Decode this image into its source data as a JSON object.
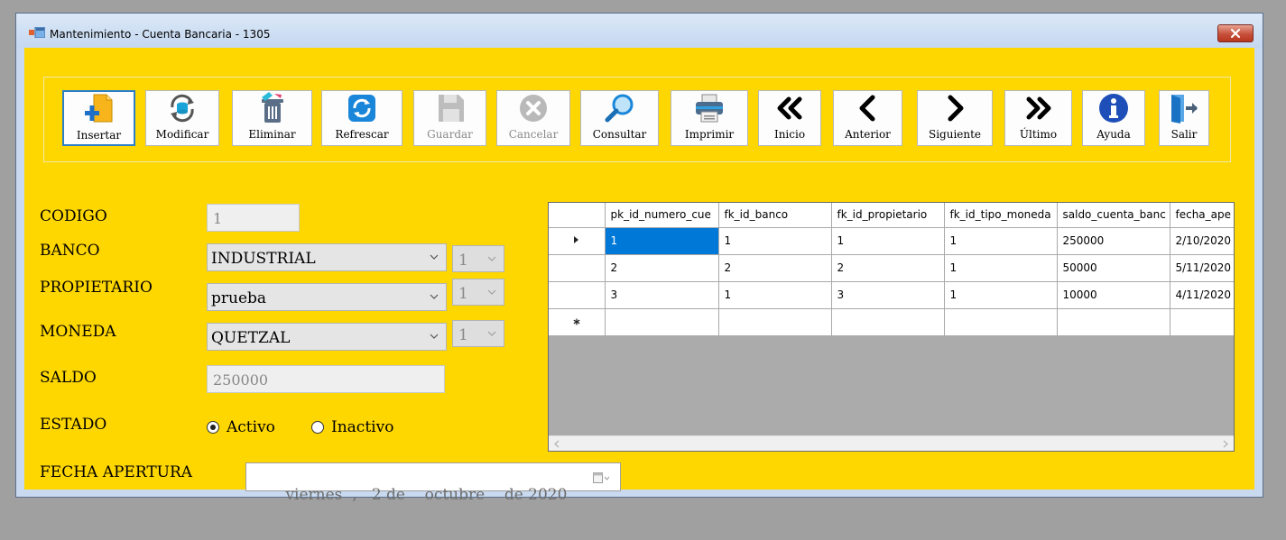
{
  "window": {
    "title": "Mantenimiento - Cuenta Bancaria - 1305"
  },
  "toolbar": [
    {
      "label": "Insertar",
      "icon": "insert-icon"
    },
    {
      "label": "Modificar",
      "icon": "modify-icon"
    },
    {
      "label": "Eliminar",
      "icon": "delete-icon"
    },
    {
      "label": "Refrescar",
      "icon": "refresh-icon"
    },
    {
      "label": "Guardar",
      "icon": "save-icon"
    },
    {
      "label": "Cancelar",
      "icon": "cancel-icon"
    },
    {
      "label": "Consultar",
      "icon": "search-icon"
    },
    {
      "label": "Imprimir",
      "icon": "printer-icon"
    },
    {
      "label": "Inicio",
      "icon": "first-icon"
    },
    {
      "label": "Anterior",
      "icon": "previous-icon"
    },
    {
      "label": "Siguiente",
      "icon": "next-icon"
    },
    {
      "label": "Último",
      "icon": "last-icon"
    },
    {
      "label": "Ayuda",
      "icon": "help-icon"
    },
    {
      "label": "Salir",
      "icon": "exit-icon"
    }
  ],
  "form": {
    "codigo_label": "CODIGO",
    "codigo_value": "1",
    "banco_label": "BANCO",
    "banco_value": "INDUSTRIAL",
    "banco_id": "1",
    "propietario_label": "PROPIETARIO",
    "propietario_value": "prueba",
    "propietario_id": "1",
    "moneda_label": "MONEDA",
    "moneda_value": "QUETZAL",
    "moneda_id": "1",
    "saldo_label": "SALDO",
    "saldo_value": "250000",
    "estado_label": "ESTADO",
    "estado_activo": "Activo",
    "estado_inactivo": "Inactivo",
    "fecha_label": "FECHA APERTURA",
    "fecha_value": "viernes  ,   2 de    octubre    de 2020"
  },
  "grid": {
    "columns": [
      "pk_id_numero_cue",
      "fk_id_banco",
      "fk_id_propietario",
      "fk_id_tipo_moneda",
      "saldo_cuenta_banc",
      "fecha_ape"
    ],
    "rows": [
      [
        "1",
        "1",
        "1",
        "1",
        "250000",
        "2/10/2020"
      ],
      [
        "2",
        "2",
        "2",
        "1",
        "50000",
        "5/11/2020"
      ],
      [
        "3",
        "1",
        "3",
        "1",
        "10000",
        "4/11/2020"
      ]
    ]
  },
  "colors": {
    "form_background": "#ffd700",
    "selection": "#0078d7"
  }
}
